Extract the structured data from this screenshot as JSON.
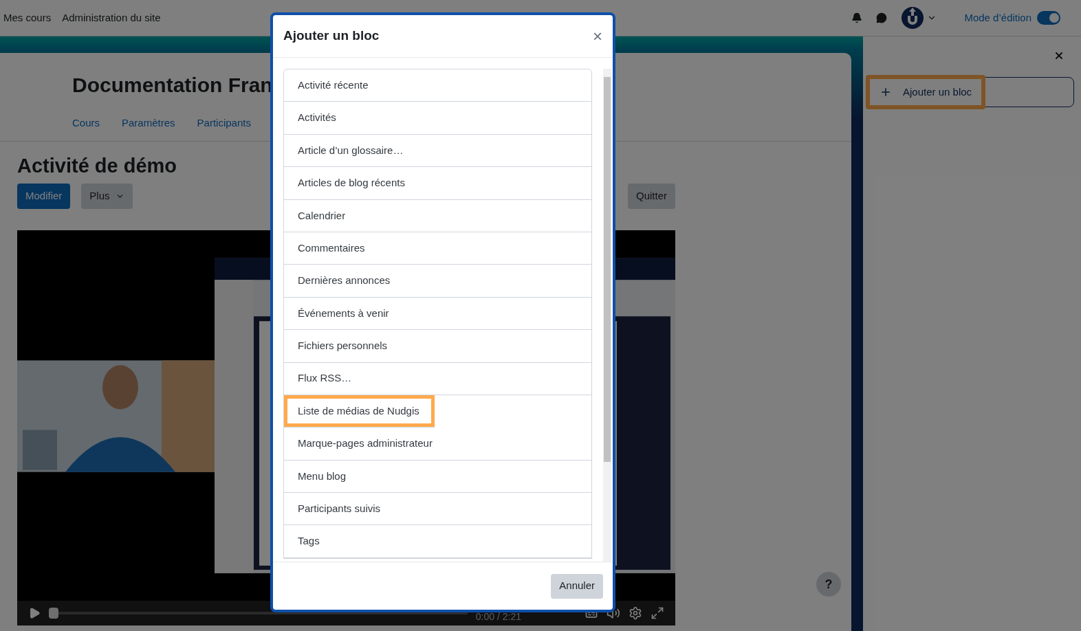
{
  "navbar": {
    "links": [
      "Mes cours",
      "Administration du site"
    ],
    "edit_mode": {
      "label": "Mode d’édition",
      "on": true
    }
  },
  "course": {
    "title": "Documentation Fran",
    "nav": [
      "Cours",
      "Paramètres",
      "Participants"
    ]
  },
  "activity": {
    "title": "Activité de démo",
    "buttons": [
      {
        "label": "Modifier",
        "kind": "primary"
      },
      {
        "label": "Plus",
        "kind": "dropdown"
      }
    ],
    "quit": "Quitter"
  },
  "video": {
    "kind": "picture",
    "time": "0:00 / 2:21",
    "progress": {
      "level": 0
    }
  },
  "drawer": {
    "add_block": {
      "label": "Ajouter un bloc",
      "highlighted": true
    }
  },
  "help": "?",
  "modal": {
    "title": "Ajouter un bloc",
    "close": "×",
    "items": [
      {
        "label": "Activité récente",
        "highlighted": false
      },
      {
        "label": "Activités",
        "highlighted": false
      },
      {
        "label": "Article d’un glossaire…",
        "highlighted": false
      },
      {
        "label": "Articles de blog récents",
        "highlighted": false
      },
      {
        "label": "Calendrier",
        "highlighted": false
      },
      {
        "label": "Commentaires",
        "highlighted": false
      },
      {
        "label": "Dernières annonces",
        "highlighted": false
      },
      {
        "label": "Événements à venir",
        "highlighted": false
      },
      {
        "label": "Fichiers personnels",
        "highlighted": false
      },
      {
        "label": "Flux RSS…",
        "highlighted": false
      },
      {
        "label": "Liste de médias de Nudgis",
        "highlighted": true
      },
      {
        "label": "Marque-pages administrateur",
        "highlighted": false
      },
      {
        "label": "Menu blog",
        "highlighted": false
      },
      {
        "label": "Participants suivis",
        "highlighted": false
      },
      {
        "label": "Tags",
        "highlighted": false
      }
    ],
    "cancel": "Annuler"
  }
}
